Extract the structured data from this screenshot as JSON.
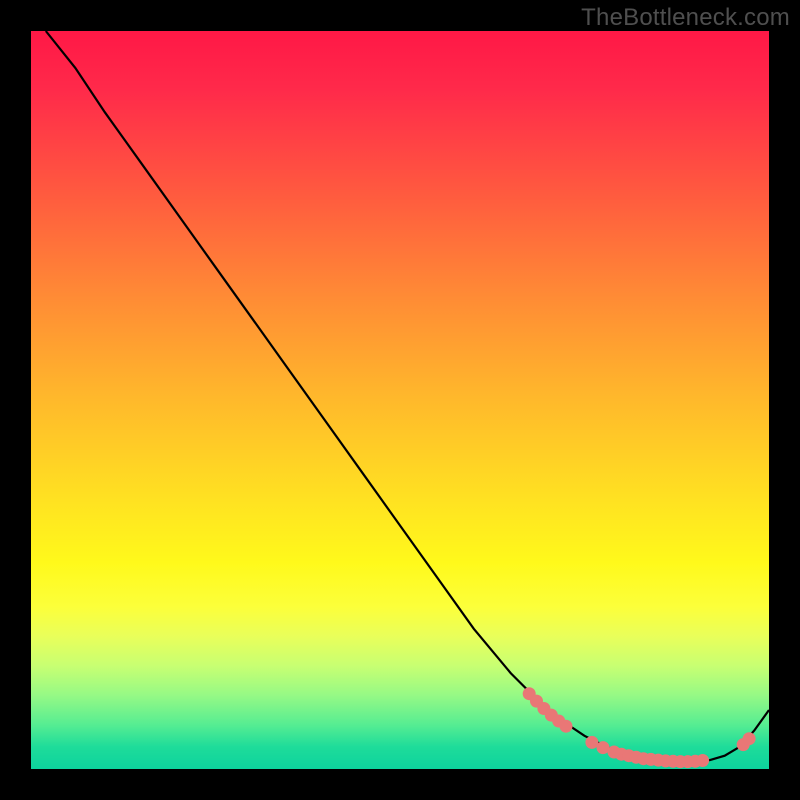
{
  "watermark": "TheBottleneck.com",
  "chart_data": {
    "type": "line",
    "title": "",
    "xlabel": "",
    "ylabel": "",
    "xlim": [
      0,
      100
    ],
    "ylim": [
      0,
      100
    ],
    "series": [
      {
        "name": "curve",
        "color": "#000000",
        "x": [
          2,
          6,
          10,
          15,
          20,
          25,
          30,
          35,
          40,
          45,
          50,
          55,
          60,
          65,
          70,
          72,
          75,
          78,
          80,
          82,
          84,
          86,
          88,
          90,
          92,
          94,
          96,
          98,
          100
        ],
        "y": [
          100,
          95,
          89,
          82,
          75,
          68,
          61,
          54,
          47,
          40,
          33,
          26,
          19,
          13,
          8,
          6.5,
          4.5,
          3,
          2.2,
          1.7,
          1.3,
          1.1,
          1.0,
          1.0,
          1.2,
          1.8,
          3.0,
          5.2,
          8.0
        ]
      },
      {
        "name": "markers",
        "color": "#e97776",
        "points": [
          {
            "x": 67.5,
            "y": 10.2
          },
          {
            "x": 68.5,
            "y": 9.2
          },
          {
            "x": 69.5,
            "y": 8.2
          },
          {
            "x": 70.5,
            "y": 7.3
          },
          {
            "x": 71.5,
            "y": 6.5
          },
          {
            "x": 72.5,
            "y": 5.8
          },
          {
            "x": 76.0,
            "y": 3.6
          },
          {
            "x": 77.5,
            "y": 2.9
          },
          {
            "x": 79.0,
            "y": 2.3
          },
          {
            "x": 80.0,
            "y": 2.0
          },
          {
            "x": 81.0,
            "y": 1.8
          },
          {
            "x": 82.0,
            "y": 1.6
          },
          {
            "x": 83.0,
            "y": 1.4
          },
          {
            "x": 84.0,
            "y": 1.3
          },
          {
            "x": 85.0,
            "y": 1.2
          },
          {
            "x": 86.0,
            "y": 1.1
          },
          {
            "x": 87.0,
            "y": 1.05
          },
          {
            "x": 88.0,
            "y": 1.0
          },
          {
            "x": 89.0,
            "y": 1.0
          },
          {
            "x": 90.0,
            "y": 1.05
          },
          {
            "x": 91.0,
            "y": 1.15
          },
          {
            "x": 96.5,
            "y": 3.3
          },
          {
            "x": 97.3,
            "y": 4.1
          }
        ]
      }
    ]
  }
}
